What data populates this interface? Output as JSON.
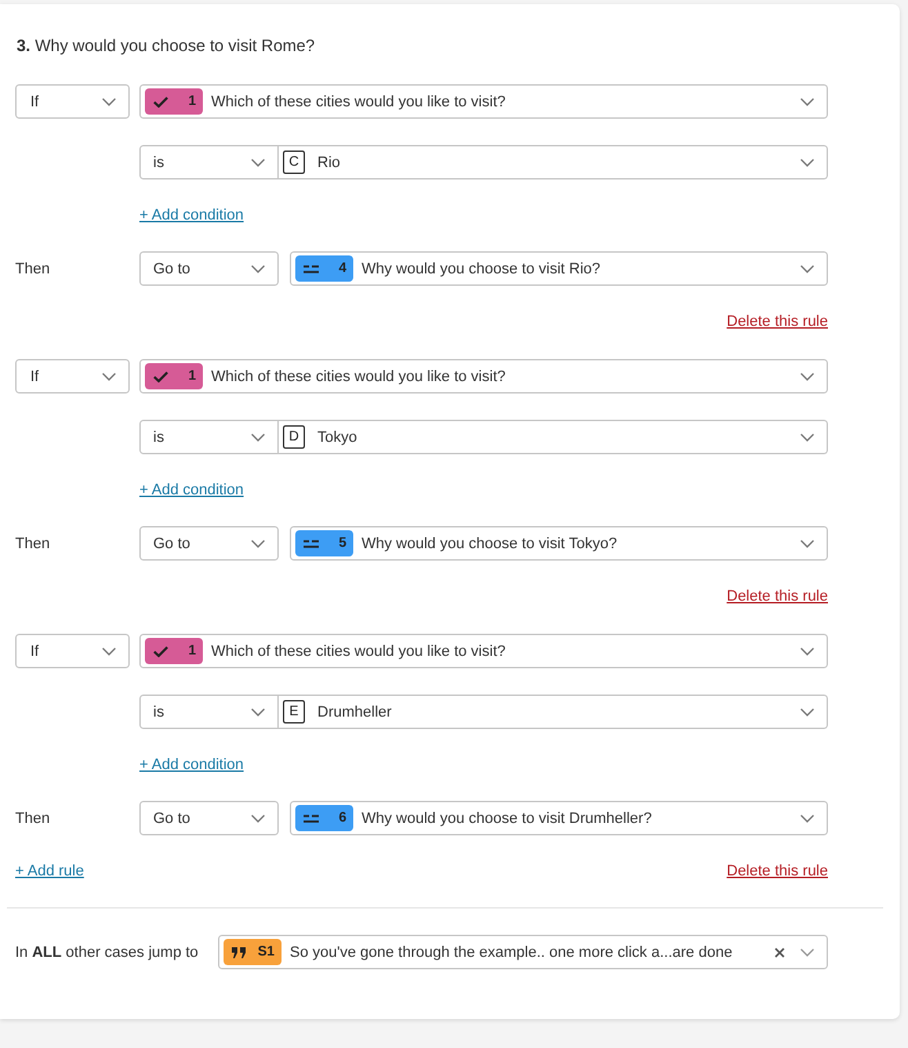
{
  "title": "**3.** Why would you choose to visit Rome?",
  "rules": [
    {
      "condition_type": "If",
      "question": {
        "kind": "multiple_choice",
        "color": "#d65b96",
        "number": "1",
        "text": "Which of these cities would you like to visit?"
      },
      "conditions": [
        {
          "operator": "is",
          "choice": {
            "letter": "C",
            "text": "Rio"
          }
        }
      ],
      "add_condition": "+ Add condition",
      "then_label": "Then",
      "action": "Go to",
      "target": {
        "kind": "short_text",
        "color": "#3d9df4",
        "number": "4",
        "text": "Why would you choose to visit Rio?"
      },
      "delete": "Delete this rule"
    },
    {
      "condition_type": "If",
      "question": {
        "kind": "multiple_choice",
        "color": "#d65b96",
        "number": "1",
        "text": "Which of these cities would you like to visit?"
      },
      "conditions": [
        {
          "operator": "is",
          "choice": {
            "letter": "D",
            "text": "Tokyo"
          }
        }
      ],
      "add_condition": "+ Add condition",
      "then_label": "Then",
      "action": "Go to",
      "target": {
        "kind": "short_text",
        "color": "#3d9df4",
        "number": "5",
        "text": "Why would you choose to visit Tokyo?"
      },
      "delete": "Delete this rule"
    },
    {
      "condition_type": "If",
      "question": {
        "kind": "multiple_choice",
        "color": "#d65b96",
        "number": "1",
        "text": "Which of these cities would you like to visit?"
      },
      "conditions": [
        {
          "operator": "is",
          "choice": {
            "letter": "E",
            "text": "Drumheller"
          }
        }
      ],
      "add_condition": "+ Add condition",
      "then_label": "Then",
      "action": "Go to",
      "target": {
        "kind": "short_text",
        "color": "#3d9df4",
        "number": "6",
        "text": "Why would you choose to visit Drumheller?"
      },
      "delete": "Delete this rule"
    }
  ],
  "add_rule": "+ Add rule",
  "fallback": {
    "label": "In **ALL** other cases jump to",
    "target": {
      "kind": "statement",
      "color": "#f8a13b",
      "number": "S1",
      "text": "So you've gone through the example.. one more click a...are done"
    },
    "clearable": true
  }
}
